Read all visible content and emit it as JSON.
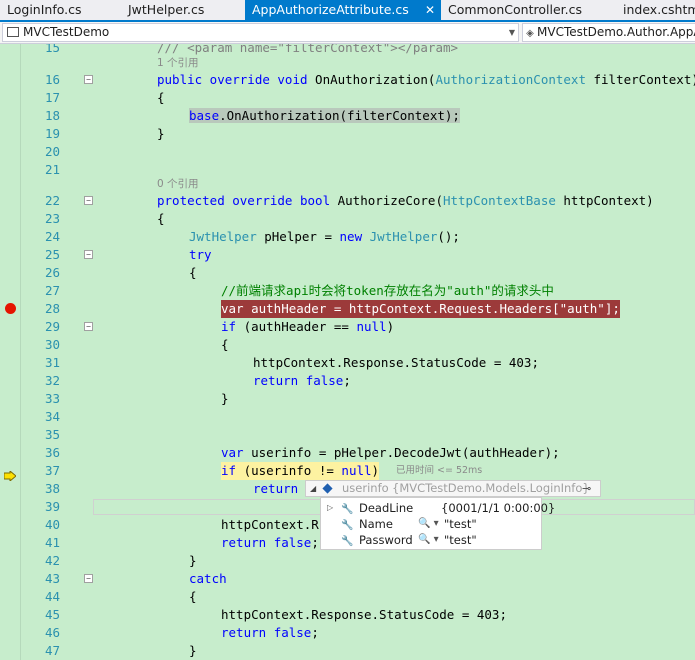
{
  "tabs": [
    {
      "label": "LoginInfo.cs",
      "active": false
    },
    {
      "label": "JwtHelper.cs",
      "active": false
    },
    {
      "label": "AppAuthorizeAttribute.cs",
      "active": true
    },
    {
      "label": "CommonController.cs",
      "active": false
    },
    {
      "label": "index.cshtml",
      "active": false
    }
  ],
  "tab_close_glyph": "✕",
  "nav": {
    "project": "MVCTestDemo",
    "type": "MVCTestDemo.Author.AppAuthorizeAttribute"
  },
  "lines": {
    "l15": "15",
    "l16": "16",
    "l17": "17",
    "l18": "18",
    "l19": "19",
    "l20": "20",
    "l21": "21",
    "l22": "22",
    "l23": "23",
    "l24": "24",
    "l25": "25",
    "l26": "26",
    "l27": "27",
    "l28": "28",
    "l29": "29",
    "l30": "30",
    "l31": "31",
    "l32": "32",
    "l33": "33",
    "l34": "34",
    "l35": "35",
    "l36": "36",
    "l37": "37",
    "l38": "38",
    "l39": "39",
    "l40": "40",
    "l41": "41",
    "l42": "42",
    "l43": "43",
    "l44": "44",
    "l45": "45",
    "l46": "46",
    "l47": "47"
  },
  "code": {
    "c15": "/// <param name=\"filterContext\"></param>",
    "lens1": "1 个引用",
    "c16a": "public override void ",
    "c16b": "OnAuthorization(",
    "c16c": "AuthorizationContext",
    "c16d": " filterContext)",
    "c17": "{",
    "c18a": "base",
    "c18b": ".OnAuthorization(filterContext);",
    "c19": "}",
    "lens2": "0 个引用",
    "c22a": "protected override bool ",
    "c22b": "AuthorizeCore(",
    "c22c": "HttpContextBase",
    "c22d": " httpContext)",
    "c23": "{",
    "c24a": "JwtHelper",
    "c24b": " pHelper = ",
    "c24c": "new ",
    "c24d": "JwtHelper",
    "c24e": "();",
    "c25": "try",
    "c26": "{",
    "c27": "//前端请求api时会将token存放在名为\"auth\"的请求头中",
    "c28a": "var",
    "c28b": " authHeader = httpContext.Request.Headers[",
    "c28c": "\"auth\"",
    "c28d": "];",
    "c29a": "if",
    "c29b": " (authHeader == ",
    "c29c": "null",
    "c29d": ")",
    "c30": "{",
    "c31": "httpContext.Response.StatusCode = 403;",
    "c32a": "return ",
    "c32b": "false",
    "c32c": ";",
    "c33": "}",
    "c36a": "var",
    "c36b": " userinfo = pHelper.DecodeJwt(authHeader);",
    "c37a": "if",
    "c37b": " (userinfo != ",
    "c37c": "null",
    "c37d": ")",
    "elapsed": "已用时间 <= 52ms",
    "c38": "return",
    "c40": "httpContext.R",
    "c41a": "return ",
    "c41b": "false",
    "c41c": ";",
    "c42": "}",
    "c43": "catch",
    "c44": "{",
    "c45": "httpContext.Response.StatusCode = 403;",
    "c46a": "return ",
    "c46b": "false",
    "c46c": ";",
    "c47": "}"
  },
  "datatip": {
    "name": "userinfo",
    "value": "{MVCTestDemo.Models.LoginInfo}",
    "members": [
      {
        "name": "DeadLine",
        "value": "{0001/1/1 0:00:00}"
      },
      {
        "name": "Name",
        "value": "\"test\""
      },
      {
        "name": "Password",
        "value": "\"test\""
      }
    ]
  },
  "colors": {
    "editor_bg": "#c7edcc",
    "breakpoint": "#e51400",
    "active_tab": "#007acc",
    "keyword": "#0000ff",
    "type": "#2b91af"
  }
}
